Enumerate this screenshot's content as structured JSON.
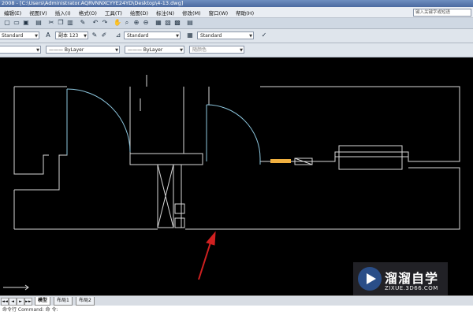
{
  "window": {
    "title": "2008 - [C:\\Users\\Administrator.AQRVNNXCYYE24YD\\Desktop\\4-13.dwg]"
  },
  "menu": {
    "items": [
      "编辑(E)",
      "视图(V)",
      "插入(I)",
      "格式(O)",
      "工具(T)",
      "绘图(D)",
      "标注(N)",
      "修改(M)",
      "窗口(W)",
      "帮助(H)"
    ],
    "help_placeholder": "键入关键字或短语"
  },
  "toolbar1": {
    "text_style": "Standard",
    "font_label": "副本 123",
    "dim_style": "Standard",
    "table_style": "Standard"
  },
  "toolbar2": {
    "linetype": "ByLayer",
    "lineweight": "ByLayer",
    "plotstyle": "随颜色"
  },
  "tabs": {
    "items": [
      "模型",
      "布局1",
      "布局2"
    ],
    "active": 0,
    "nav": [
      "◄◄",
      "◄",
      "►",
      "►►"
    ]
  },
  "command": {
    "text": "命令行 Command: 命 令:"
  },
  "watermark": {
    "brand": "溜溜自学",
    "url": "ZIXUE.3D66.COM"
  },
  "colors": {
    "cad_line": "#d8d8d8",
    "door_line": "#8ec8e0",
    "highlight": "#f0b040",
    "arrow": "#d02020"
  }
}
